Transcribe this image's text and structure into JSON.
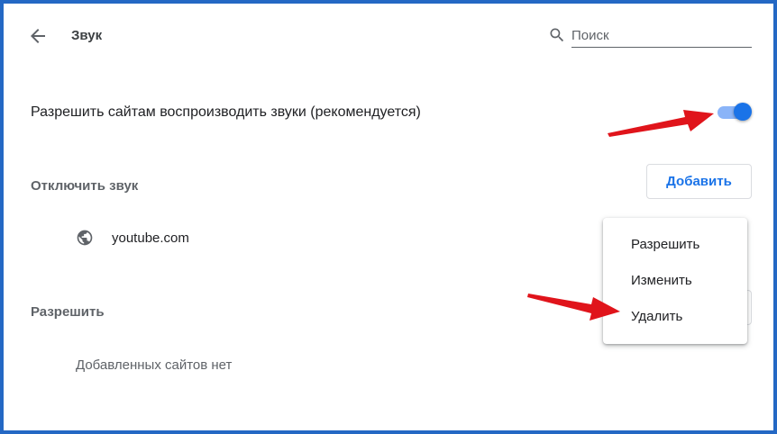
{
  "header": {
    "title": "Звук",
    "back_icon": "arrow-left-icon",
    "search": {
      "placeholder": "Поиск",
      "value": "",
      "icon": "search-icon"
    }
  },
  "allow_sound": {
    "label": "Разрешить сайтам воспроизводить звуки (рекомендуется)",
    "enabled": true
  },
  "mute_section": {
    "title": "Отключить звук",
    "add_label": "Добавить",
    "sites": [
      {
        "name": "youtube.com",
        "icon": "globe-icon"
      }
    ]
  },
  "allow_section": {
    "title": "Разрешить",
    "empty_text": "Добавленных сайтов нет"
  },
  "context_menu": {
    "items": [
      {
        "label": "Разрешить"
      },
      {
        "label": "Изменить"
      },
      {
        "label": "Удалить"
      }
    ]
  },
  "colors": {
    "frame_border": "#2468c4",
    "accent": "#1a73e8",
    "annotation_arrow": "#e0141b"
  }
}
